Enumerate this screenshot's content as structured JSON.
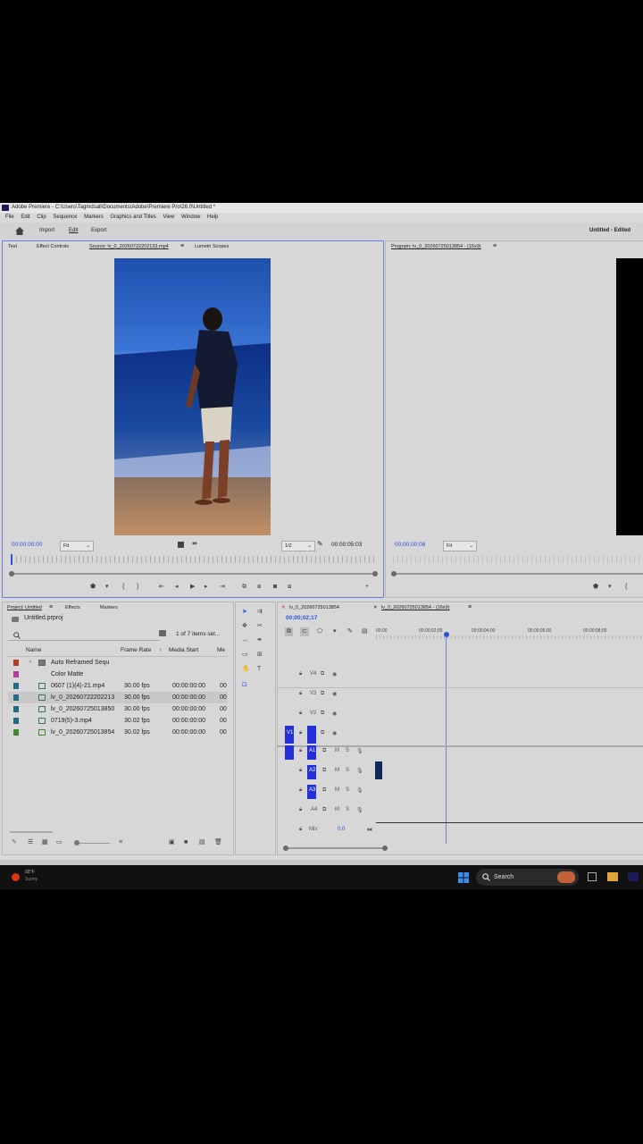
{
  "window": {
    "title": "Adobe Premiere - C:\\Users\\Tagmdsall\\Documents\\Adobe\\Premiere Pro\\26.0\\Untitled *"
  },
  "menu": [
    "File",
    "Edit",
    "Clip",
    "Sequence",
    "Markers",
    "Graphics and Titles",
    "View",
    "Window",
    "Help"
  ],
  "workspace": {
    "tabs": [
      "Import",
      "Edit",
      "Export"
    ],
    "active_tab": "Edit",
    "project_status": "Untitled - Edited"
  },
  "source_panel": {
    "tabs": [
      "Text",
      "Effect Controls",
      "Source: lv_0_20260722202133.mp4",
      "Lumetri Scopes"
    ],
    "timecode_in": "00:00:00:00",
    "fit": "Fit",
    "resolution": "1/2",
    "duration": "00:00:05:03"
  },
  "program_panel": {
    "tab": "Program: lv_0_20260725013854 - (16x9)",
    "timecode": "00;00;00;08",
    "fit": "Fit"
  },
  "project_panel": {
    "tabs": [
      "Project: Untitled",
      "Effects",
      "Markers"
    ],
    "project_file": "Untitled.prproj",
    "selection_count": "1 of 7 items sel...",
    "columns": [
      "Name",
      "Frame Rate",
      "Media Start",
      "Me"
    ],
    "rows": [
      {
        "name": "Auto Reframed Sequ",
        "frame_rate": "",
        "media_start": "",
        "extra": "",
        "color": "#b53a2a",
        "kind": "folder"
      },
      {
        "name": "Color Matte",
        "frame_rate": "",
        "media_start": "",
        "extra": "",
        "color": "#b23a9a",
        "kind": "matte"
      },
      {
        "name": "0607 (1)(4)-21.mp4",
        "frame_rate": "30.00 fps",
        "media_start": "00:00:00:00",
        "extra": "00",
        "color": "#1f6b8a",
        "kind": "clip"
      },
      {
        "name": "lv_0_20260722202213",
        "frame_rate": "30.00 fps",
        "media_start": "00:00:00:00",
        "extra": "00",
        "color": "#1f6b8a",
        "kind": "clip"
      },
      {
        "name": "lv_0_20260725013850",
        "frame_rate": "30.00 fps",
        "media_start": "00:00:00:00",
        "extra": "00",
        "color": "#1f6b8a",
        "kind": "clip"
      },
      {
        "name": "0719(5)-3.mp4",
        "frame_rate": "30.02 fps",
        "media_start": "00:00:00:00",
        "extra": "00",
        "color": "#1f6b8a",
        "kind": "clip"
      },
      {
        "name": "lv_0_20260725013854",
        "frame_rate": "30.02 fps",
        "media_start": "00:00:00:00",
        "extra": "00",
        "color": "#3c8a2a",
        "kind": "sequence"
      }
    ]
  },
  "timeline": {
    "tabs": [
      "lv_0_20260725013854",
      "lv_0_20260725013854 - (16x9)"
    ],
    "timecode": "00;00;02;17",
    "ruler": [
      "00;00",
      "00;00;02;00",
      "00;00;04;00",
      "00;00;06;00",
      "00;00;08;00"
    ],
    "video_tracks": [
      "V4",
      "V3",
      "V2",
      "V1"
    ],
    "audio_tracks": [
      "A1",
      "A2",
      "A3"
    ],
    "mix_label": "Mix",
    "mix_value": "0.0"
  },
  "taskbar": {
    "weather_temp": "92°F",
    "weather_text": "Sunny",
    "search_label": "Search"
  },
  "colors": {
    "accent": "#2b53d6",
    "track_target": "#2330d8",
    "panel": "#d7d7d7"
  }
}
